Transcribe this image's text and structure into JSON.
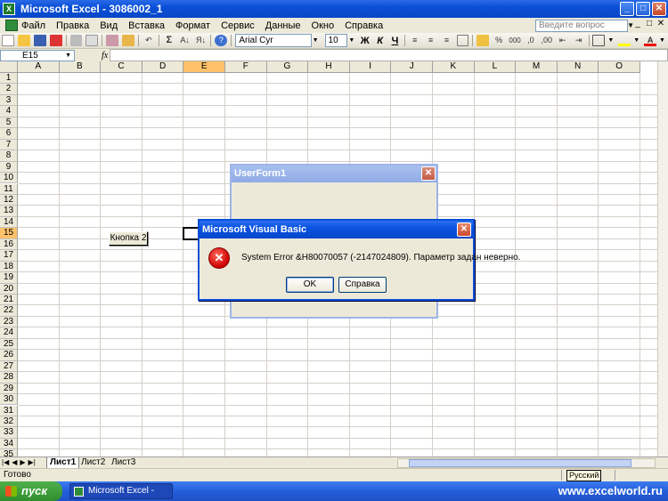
{
  "window": {
    "title": "Microsoft Excel - 3086002_1",
    "app_icon_glyph": "X",
    "minimize": "_",
    "maximize": "□",
    "close": "✕"
  },
  "menu": {
    "items": [
      "Файл",
      "Правка",
      "Вид",
      "Вставка",
      "Формат",
      "Сервис",
      "Данные",
      "Окно",
      "Справка"
    ],
    "help_placeholder": "Введите вопрос",
    "mdi_controls": [
      "_",
      "□",
      "✕"
    ]
  },
  "toolbar": {
    "font": "Arial Cyr",
    "size": "10",
    "sum_glyph": "Σ",
    "bold": "Ж",
    "italic": "К",
    "underline": "Ч",
    "percent": "%",
    "thousands": "000",
    "align_glyph": "≡"
  },
  "formula_bar": {
    "cell_ref": "E15",
    "fx": "fx",
    "value": ""
  },
  "grid": {
    "columns": [
      "A",
      "B",
      "C",
      "D",
      "E",
      "F",
      "G",
      "H",
      "I",
      "J",
      "K",
      "L",
      "M",
      "N",
      "O"
    ],
    "rows": [
      "1",
      "2",
      "3",
      "4",
      "5",
      "6",
      "7",
      "8",
      "9",
      "10",
      "11",
      "12",
      "13",
      "14",
      "15",
      "16",
      "17",
      "18",
      "19",
      "20",
      "21",
      "22",
      "23",
      "24",
      "25",
      "26",
      "27",
      "28",
      "29",
      "30",
      "31",
      "32",
      "33",
      "34",
      "35"
    ],
    "active_column": "E",
    "active_row": "15",
    "button_label": "Кнопка 2"
  },
  "sheets": {
    "nav": [
      "|◀",
      "◀",
      "▶",
      "▶|"
    ],
    "tabs": [
      "Лист1",
      "Лист2",
      "Лист3"
    ],
    "active": "Лист1"
  },
  "status": {
    "text": "Готово",
    "language": "Русский"
  },
  "taskbar": {
    "start": "пуск",
    "task": "Microsoft Excel - 308...",
    "watermark": "www.excelworld.ru"
  },
  "userform": {
    "title": "UserForm1",
    "close": "✕"
  },
  "msgbox": {
    "title": "Microsoft Visual Basic",
    "close": "✕",
    "icon_glyph": "✕",
    "message": "System Error &H80070057 (-2147024809).   Параметр задан неверно.",
    "ok": "OK",
    "help": "Справка"
  }
}
